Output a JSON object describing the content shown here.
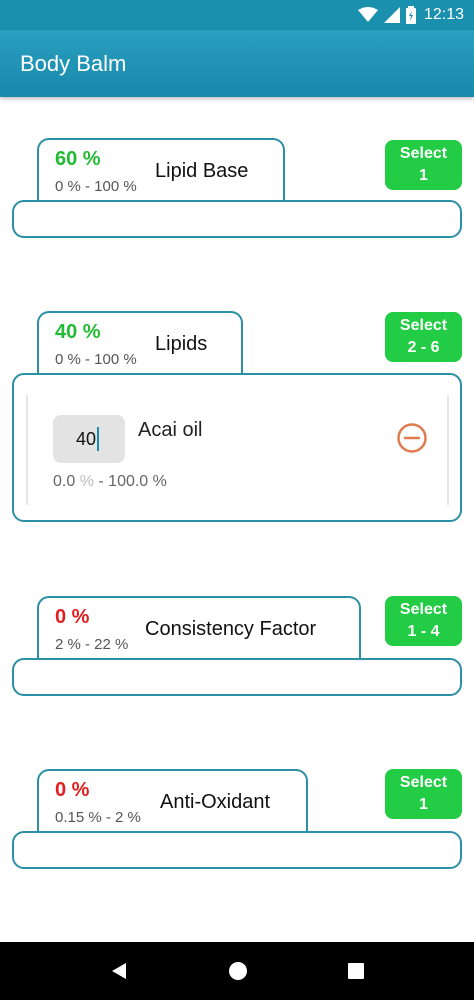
{
  "status_bar": {
    "time": "12:13"
  },
  "app_bar": {
    "title": "Body Balm"
  },
  "sections": [
    {
      "percent": "60 %",
      "percent_status": "ok",
      "range": "0 % - 100 %",
      "name": "Lipid Base",
      "select": {
        "line1": "Select",
        "line2": "1"
      }
    },
    {
      "percent": "40 %",
      "percent_status": "ok",
      "range": "0 % - 100 %",
      "name": "Lipids",
      "select": {
        "line1": "Select",
        "line2": "2 - 6"
      },
      "ingredients": [
        {
          "value": "40",
          "name": "Acai oil",
          "range_min": "0.0",
          "range_unit": "%",
          "range_rest": "- 100.0 %"
        }
      ]
    },
    {
      "percent": "0 %",
      "percent_status": "error",
      "range": "2 % - 22 %",
      "name": "Consistency Factor",
      "select": {
        "line1": "Select",
        "line2": "1 - 4"
      }
    },
    {
      "percent": "0 %",
      "percent_status": "error",
      "range": "0.15 % - 2 %",
      "name": "Anti-Oxidant",
      "select": {
        "line1": "Select",
        "line2": "1"
      }
    }
  ],
  "colors": {
    "primary": "#1a8fae",
    "border": "#2b8fa5",
    "ok": "#22bb33",
    "error": "#e02020",
    "select_button": "#22cc44",
    "remove_icon": "#e07b4f"
  },
  "icons": {
    "wifi": "wifi-icon",
    "signal": "signal-icon",
    "battery": "battery-icon",
    "remove": "remove-circle-icon",
    "back": "back-icon",
    "home": "home-icon",
    "recents": "recents-icon"
  }
}
